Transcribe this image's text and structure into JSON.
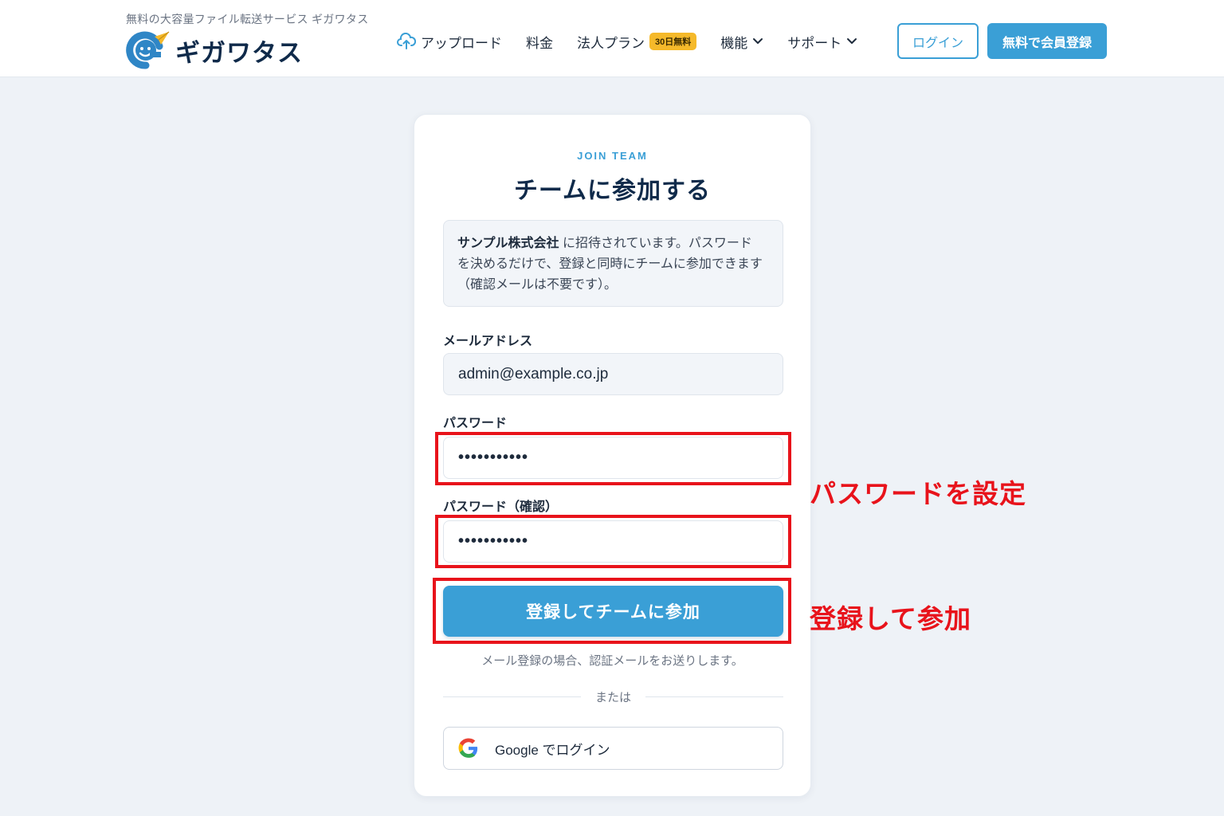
{
  "header": {
    "tagline": "無料の大容量ファイル転送サービス ギガワタス",
    "logo_text": "ギガワタス",
    "nav": [
      {
        "label": "アップロード"
      },
      {
        "label": "料金"
      },
      {
        "label": "法人プラン",
        "badge": "30日無料"
      },
      {
        "label": "機能"
      },
      {
        "label": "サポート"
      }
    ],
    "login_label": "ログイン",
    "register_label": "無料で会員登録"
  },
  "card": {
    "eyebrow": "JOIN TEAM",
    "title": "チームに参加する",
    "notice_company": "サンプル株式会社",
    "notice_text_1": " に招待されています。パスワード",
    "notice_text_2": "を決めるだけで、登録と同時にチームに参加できます",
    "notice_text_3": "（確認メールは不要です）。",
    "email_label": "メールアドレス",
    "email_value": "admin@example.co.jp",
    "password_label": "パスワード",
    "password_value": "•••••••••••",
    "password_confirm_label": "パスワード（確認）",
    "password_confirm_value": "•••••••••••",
    "submit_label": "登録してチームに参加",
    "hint": "メール登録の場合、認証メールをお送りします。",
    "divider_text": "または",
    "google_label": "Google でログイン"
  },
  "annotations": {
    "password_note": "パスワードを設定",
    "submit_note": "登録して参加",
    "color": "#e8131b"
  },
  "colors": {
    "accent": "#3a9fd6",
    "badge": "#f5b92a",
    "title": "#0f2a4a"
  }
}
